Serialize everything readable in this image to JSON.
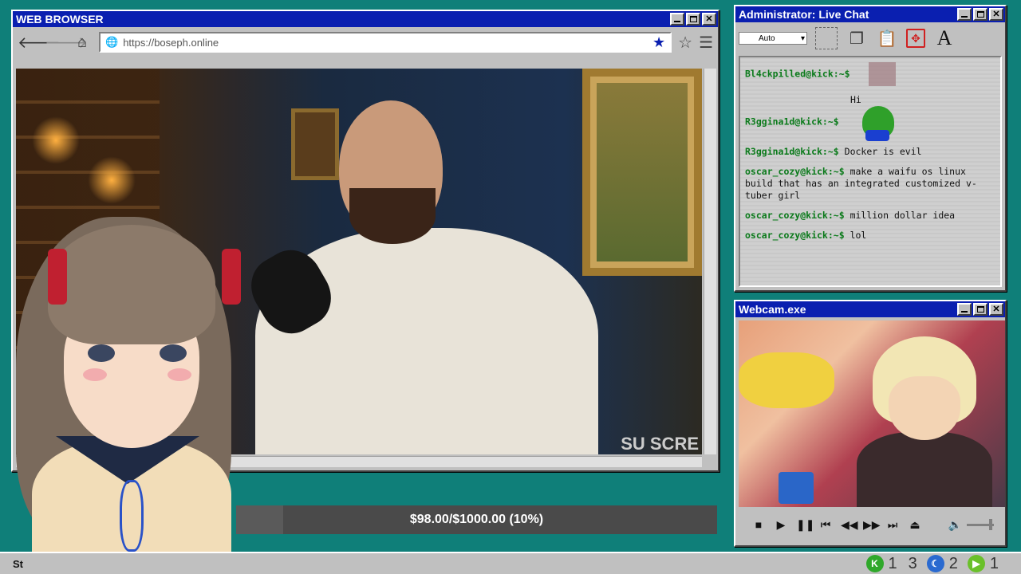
{
  "browser": {
    "title": "WEB BROWSER",
    "url": "https://boseph.online",
    "video_overlay": "SU SCRE"
  },
  "chat": {
    "title": "Administrator: Live Chat",
    "dropdown_value": "Auto",
    "messages": [
      {
        "user": "Bl4ckpilled@kick:~$",
        "text": ""
      },
      {
        "user": "",
        "text": "Hi"
      },
      {
        "user": "R3ggina1d@kick:~$",
        "text": ""
      },
      {
        "user": "R3ggina1d@kick:~$",
        "text": "Docker is evil"
      },
      {
        "user": "oscar_cozy@kick:~$",
        "text": "make a waifu os linux build that has an integrated customized v-tuber girl"
      },
      {
        "user": "oscar_cozy@kick:~$",
        "text": "million dollar idea"
      },
      {
        "user": "oscar_cozy@kick:~$",
        "text": "lol"
      }
    ]
  },
  "webcam": {
    "title": "Webcam.exe"
  },
  "donation": {
    "text": "$98.00/$1000.00 (10%)",
    "progress": 0.098
  },
  "taskbar": {
    "start_label": "St",
    "counts": [
      "1",
      "3",
      "2",
      "1"
    ]
  },
  "colors": {
    "desktop": "#0f7f79",
    "titlebar": "#0a1fb0",
    "chat_user": "#0a7a1a"
  }
}
